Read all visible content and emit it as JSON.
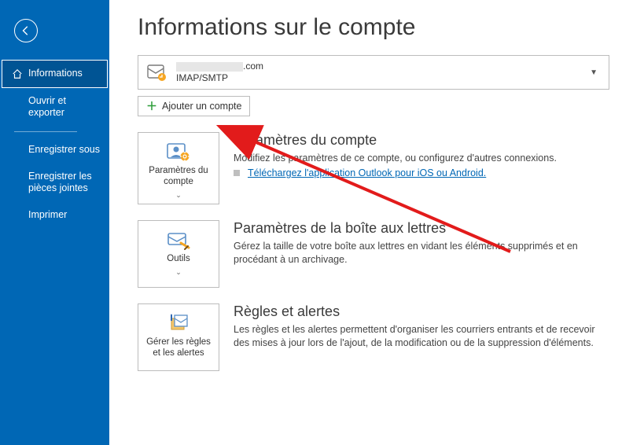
{
  "sidebar": {
    "items": [
      {
        "label": "Informations"
      },
      {
        "label": "Ouvrir et exporter"
      },
      {
        "label": "Enregistrer sous"
      },
      {
        "label": "Enregistrer les pièces jointes"
      },
      {
        "label": "Imprimer"
      }
    ]
  },
  "page": {
    "title": "Informations sur le compte"
  },
  "account": {
    "domain_suffix": ".com",
    "protocol": "IMAP/SMTP"
  },
  "add_account_label": "Ajouter un compte",
  "sections": [
    {
      "tile_label": "Paramètres du compte",
      "title": "Paramètres du compte",
      "desc": "Modifiez les paramètres de ce compte, ou configurez d'autres connexions.",
      "link": "Téléchargez l'application Outlook pour iOS ou Android."
    },
    {
      "tile_label": "Outils",
      "title": "Paramètres de la boîte aux lettres",
      "desc": "Gérez la taille de votre boîte aux lettres en vidant les éléments supprimés et en procédant à un archivage."
    },
    {
      "tile_label": "Gérer les règles et les alertes",
      "title": "Règles et alertes",
      "desc": "Les règles et les alertes permettent d'organiser les courriers entrants et de recevoir des mises à jour lors de l'ajout, de la modification ou de la suppression d'éléments."
    }
  ]
}
